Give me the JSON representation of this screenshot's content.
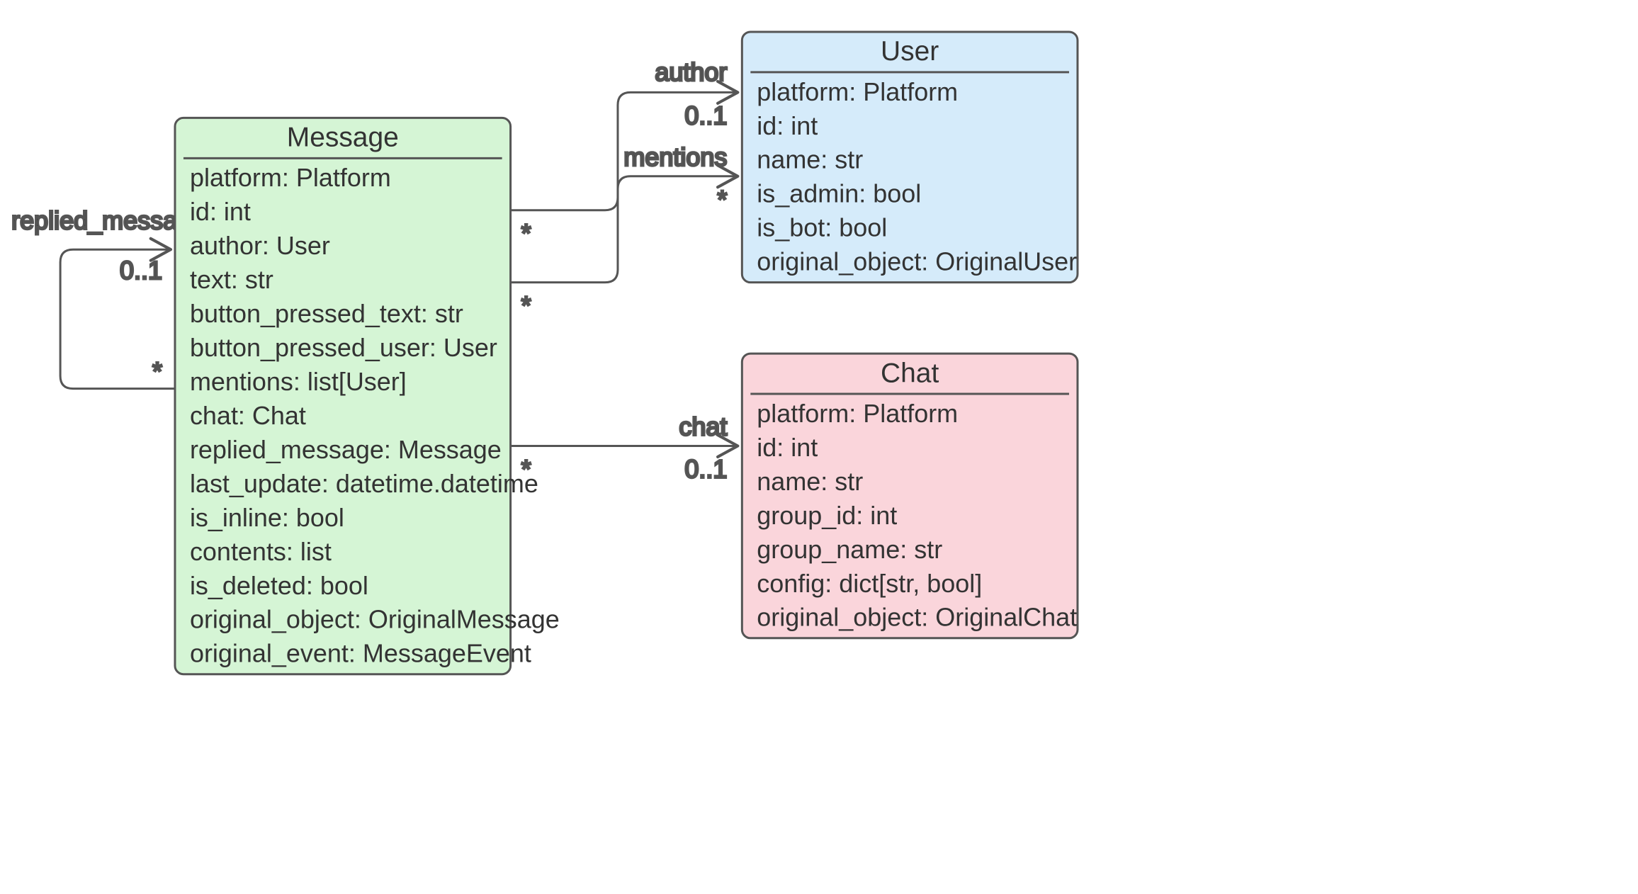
{
  "classes": {
    "message": {
      "title": "Message",
      "fill": "#D5F5D5",
      "attrs": [
        "platform: Platform",
        "id: int",
        "author: User",
        "text: str",
        "button_pressed_text: str",
        "button_pressed_user: User",
        "mentions: list[User]",
        "chat: Chat",
        "replied_message: Message",
        "last_update: datetime.datetime",
        "is_inline: bool",
        "contents: list",
        "is_deleted: bool",
        "original_object: OriginalMessage",
        "original_event: MessageEvent"
      ]
    },
    "user": {
      "title": "User",
      "fill": "#D5EBFA",
      "attrs": [
        "platform: Platform",
        "id: int",
        "name: str",
        "is_admin: bool",
        "is_bot: bool",
        "original_object: OriginalUser"
      ]
    },
    "chat": {
      "title": "Chat",
      "fill": "#FAD5DB",
      "attrs": [
        "platform: Platform",
        "id: int",
        "name: str",
        "group_id: int",
        "group_name: str",
        "config: dict[str, bool]",
        "original_object: OriginalChat"
      ]
    }
  },
  "edges": {
    "replied_message": {
      "name": "replied_message",
      "src_mult": "*",
      "dst_mult": "0..1"
    },
    "author": {
      "name": "author",
      "src_mult": "*",
      "dst_mult": "0..1"
    },
    "mentions": {
      "name": "mentions",
      "src_mult": "*",
      "dst_mult": "*"
    },
    "chat": {
      "name": "chat",
      "src_mult": "*",
      "dst_mult": "0..1"
    }
  }
}
